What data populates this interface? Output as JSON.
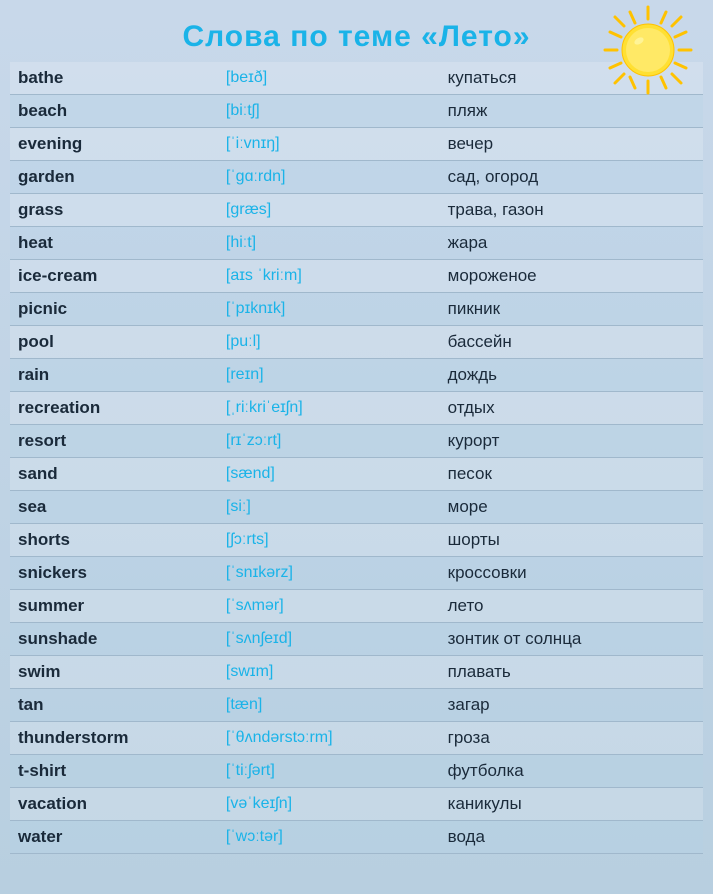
{
  "title": "Слова по теме «Лето»",
  "words": [
    {
      "word": "bathe",
      "transcription": "[beɪð]",
      "translation": "купаться"
    },
    {
      "word": "beach",
      "transcription": "[biːtʃ]",
      "translation": "пляж"
    },
    {
      "word": "evening",
      "transcription": "[ˈiːvnɪŋ]",
      "translation": "вечер"
    },
    {
      "word": "garden",
      "transcription": "[ˈɡɑːrdn]",
      "translation": "сад, огород"
    },
    {
      "word": "grass",
      "transcription": "[ɡræs]",
      "translation": "трава, газон"
    },
    {
      "word": "heat",
      "transcription": "[hiːt]",
      "translation": "жара"
    },
    {
      "word": "ice-cream",
      "transcription": "[aɪs ˈkriːm]",
      "translation": "мороженое"
    },
    {
      "word": "picnic",
      "transcription": "[ˈpɪknɪk]",
      "translation": "пикник"
    },
    {
      "word": "pool",
      "transcription": "[puːl]",
      "translation": "бассейн"
    },
    {
      "word": "rain",
      "transcription": "[reɪn]",
      "translation": "дождь"
    },
    {
      "word": "recreation",
      "transcription": "[ˌriːkriˈeɪʃn]",
      "translation": "отдых"
    },
    {
      "word": "resort",
      "transcription": "[rɪˈzɔːrt]",
      "translation": "курорт"
    },
    {
      "word": "sand",
      "transcription": "[sænd]",
      "translation": "песок"
    },
    {
      "word": "sea",
      "transcription": "[siː]",
      "translation": "море"
    },
    {
      "word": "shorts",
      "transcription": "[ʃɔːrts]",
      "translation": "шорты"
    },
    {
      "word": "snickers",
      "transcription": "[ˈsnɪkərz]",
      "translation": "кроссовки"
    },
    {
      "word": "summer",
      "transcription": "[ˈsʌmər]",
      "translation": "лето"
    },
    {
      "word": "sunshade",
      "transcription": "[ˈsʌnʃeɪd]",
      "translation": "зонтик от солнца"
    },
    {
      "word": "swim",
      "transcription": "[swɪm]",
      "translation": "плавать"
    },
    {
      "word": "tan",
      "transcription": "[tæn]",
      "translation": "загар"
    },
    {
      "word": "thunderstorm",
      "transcription": "[ˈθʌndərstɔːrm]",
      "translation": "гроза"
    },
    {
      "word": "t-shirt",
      "transcription": "[ˈtiːʃərt]",
      "translation": "футболка"
    },
    {
      "word": "vacation",
      "transcription": "[vəˈkeɪʃn]",
      "translation": "каникулы"
    },
    {
      "word": "water",
      "transcription": "[ˈwɔːtər]",
      "translation": "вода"
    }
  ]
}
